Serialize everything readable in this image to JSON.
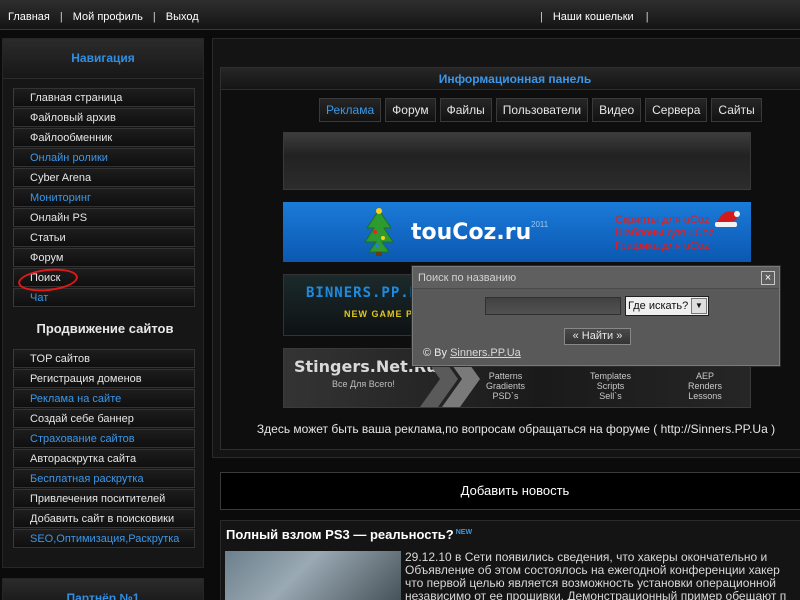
{
  "topbar": {
    "links": [
      "Главная",
      "Мой профиль",
      "Выход"
    ],
    "right_link": "Наши кошельки"
  },
  "sidebar": {
    "title": "Навигация",
    "items": [
      {
        "label": "Главная страница",
        "color": "white"
      },
      {
        "label": "Файловый архив",
        "color": "white"
      },
      {
        "label": "Файлообменник",
        "color": "white"
      },
      {
        "label": "Онлайн ролики",
        "color": "blue"
      },
      {
        "label": "Cyber Arena",
        "color": "white"
      },
      {
        "label": "Мониторинг",
        "color": "blue"
      },
      {
        "label": "Онлайн PS",
        "color": "white"
      },
      {
        "label": "Статьи",
        "color": "white"
      },
      {
        "label": "Форум",
        "color": "white"
      },
      {
        "label": "Поиск",
        "color": "white",
        "circled": true
      },
      {
        "label": "Чат",
        "color": "blue"
      }
    ],
    "promo_title": "Продвижение сайтов",
    "promo_items": [
      {
        "label": "TOP сайтов",
        "color": "white"
      },
      {
        "label": "Регистрация доменов",
        "color": "white"
      },
      {
        "label": "Реклама на сайте",
        "color": "blue"
      },
      {
        "label": "Создай себе баннер",
        "color": "white"
      },
      {
        "label": "Страхование сайтов",
        "color": "blue"
      },
      {
        "label": "Автораскрутка сайта",
        "color": "white"
      },
      {
        "label": "Бесплатная раскрутка",
        "color": "blue"
      },
      {
        "label": "Привлечения поситителей",
        "color": "white"
      },
      {
        "label": "Добавить сайт в поисковики",
        "color": "white"
      },
      {
        "label": "SEO,Оптимизация,Раскрутка",
        "color": "blue"
      }
    ],
    "next_block_title": "Партнёр №1"
  },
  "info_panel": {
    "title": "Информационная панель",
    "tabs": [
      "Реклама",
      "Форум",
      "Файлы",
      "Пользователи",
      "Видео",
      "Сервера",
      "Сайты"
    ],
    "active_tab": "Реклама",
    "banners": {
      "toucoz": {
        "name": "touCoz.ru",
        "year": "2011",
        "lines": [
          "Скрипты для uCoz",
          "Шаблоны для uCoz",
          "Графика для uCoz"
        ]
      },
      "sinners": {
        "name": "BINNERS.PP.R",
        "sub": "NEW GAME PO"
      },
      "stingers": {
        "brand": "Stingers.Net.Ru",
        "slogan": "Все Для Всего!",
        "col1": [
          "Patterns",
          "Gradients",
          "PSD`s"
        ],
        "col2": [
          "Templates",
          "Scripts",
          "Sell`s"
        ],
        "col3": [
          "AEP",
          "Renders",
          "Lessons"
        ]
      }
    },
    "notice": "Здесь может быть ваша реклама,по вопросам обращаться на форуме ( http://Sinners.PP.Ua )"
  },
  "add_news": "Добавить новость",
  "news": {
    "title": "Полный взлом PS3 — реальность?",
    "new_badge": "NEW",
    "lines": [
      "29.12.10 в Сети появились сведения, что хакеры окончательно и",
      "Объявление об этом состоялось на ежегодной конференции хакер",
      "что первой целью является возможность установки операционной",
      "независимо от ее прошивки. Демонстрационный пример обещают п"
    ]
  },
  "popup": {
    "title": "Поиск по названию",
    "close": "×",
    "input_value": "",
    "select_value": "Где искать?",
    "button": "« Найти »",
    "credit_prefix": "© By ",
    "credit_link": "Sinners.PP.Ua"
  },
  "colors": {
    "accent_blue": "#3b97ea",
    "circle_mark": "#e01818",
    "toucoz_bg": "#1b7bd9"
  }
}
